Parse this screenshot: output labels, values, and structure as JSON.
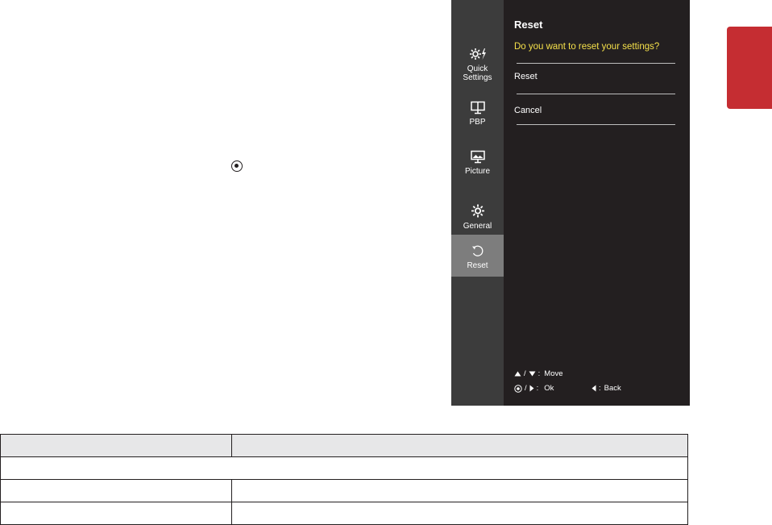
{
  "osd": {
    "nav": [
      {
        "label_line1": "Quick",
        "label_line2": "Settings",
        "icon": "quick-settings-icon",
        "active": false
      },
      {
        "label_line1": "PBP",
        "label_line2": "",
        "icon": "pbp-icon",
        "active": false
      },
      {
        "label_line1": "Picture",
        "label_line2": "",
        "icon": "picture-icon",
        "active": false
      },
      {
        "label_line1": "General",
        "label_line2": "",
        "icon": "gear-icon",
        "active": false
      },
      {
        "label_line1": "Reset",
        "label_line2": "",
        "icon": "reset-icon",
        "active": true
      }
    ],
    "panel": {
      "title": "Reset",
      "question": "Do you want to reset your settings?",
      "options": [
        "Reset",
        "Cancel"
      ]
    },
    "hints": {
      "move_sep": "/",
      "move_label": "Move",
      "ok_sep": "/",
      "ok_label": "Ok",
      "back_label": "Back",
      "colon": ":"
    },
    "colors": {
      "background": "#231f20",
      "sidebar": "#3c3c3c",
      "active_item": "#7d7d7d",
      "question": "#f5e04a",
      "lang_tab": "#c52d32"
    }
  },
  "table": {
    "header": [
      "",
      ""
    ],
    "rows": [
      [
        ""
      ],
      [
        "",
        ""
      ],
      [
        "",
        ""
      ]
    ]
  }
}
